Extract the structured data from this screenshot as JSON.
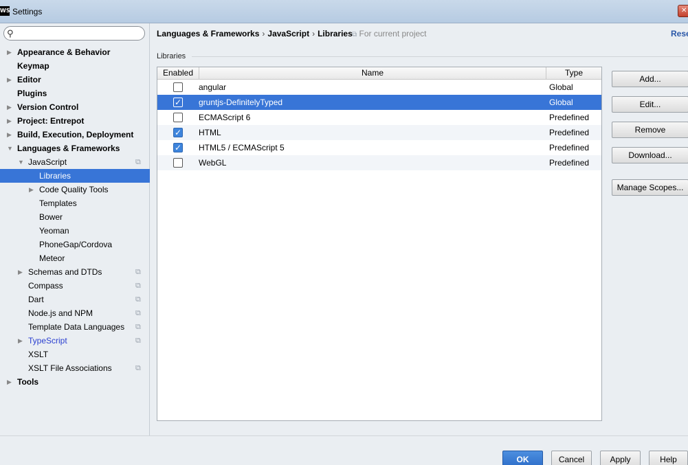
{
  "window": {
    "logo": "WS",
    "title": "Settings",
    "close_icon": "✕"
  },
  "search": {
    "placeholder": "",
    "value": "",
    "icon": "search-icon"
  },
  "tree": {
    "appearance": "Appearance & Behavior",
    "keymap": "Keymap",
    "editor": "Editor",
    "plugins": "Plugins",
    "vcs": "Version Control",
    "project": "Project: Entrepot",
    "build": "Build, Execution, Deployment",
    "languages": "Languages & Frameworks",
    "javascript": "JavaScript",
    "libraries": "Libraries",
    "code_quality": "Code Quality Tools",
    "templates": "Templates",
    "bower": "Bower",
    "yeoman": "Yeoman",
    "phonegap": "PhoneGap/Cordova",
    "meteor": "Meteor",
    "schemas": "Schemas and DTDs",
    "compass": "Compass",
    "dart": "Dart",
    "node": "Node.js and NPM",
    "template_data": "Template Data Languages",
    "typescript": "TypeScript",
    "xslt": "XSLT",
    "xslt_assoc": "XSLT File Associations",
    "tools": "Tools"
  },
  "breadcrumb": {
    "items": [
      "Languages & Frameworks",
      "JavaScript",
      "Libraries"
    ],
    "separator": "›",
    "current_project": "For current project",
    "reset": "Rese"
  },
  "section": {
    "label": "Libraries"
  },
  "table": {
    "headers": {
      "enabled": "Enabled",
      "name": "Name",
      "type": "Type"
    },
    "rows": [
      {
        "name": "angular",
        "type": "Global",
        "checked": false
      },
      {
        "name": "gruntjs-DefinitelyTyped",
        "type": "Global",
        "checked": true
      },
      {
        "name": "ECMAScript 6",
        "type": "Predefined",
        "checked": false
      },
      {
        "name": "HTML",
        "type": "Predefined",
        "checked": true
      },
      {
        "name": "HTML5 / ECMAScript 5",
        "type": "Predefined",
        "checked": true
      },
      {
        "name": "WebGL",
        "type": "Predefined",
        "checked": false
      }
    ],
    "selected_row": 1
  },
  "buttons": {
    "add": "Add...",
    "edit": "Edit...",
    "remove": "Remove",
    "download": "Download...",
    "manage_scopes": "Manage Scopes..."
  },
  "footer": {
    "ok": "OK",
    "cancel": "Cancel",
    "apply": "Apply",
    "help": "Help"
  },
  "colors": {
    "selection": "#3875d7",
    "link": "#2a3fd0",
    "background": "#eaeef2"
  }
}
